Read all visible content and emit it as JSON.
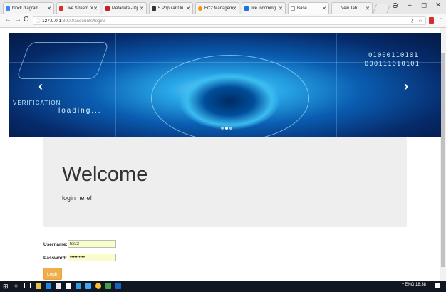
{
  "browser": {
    "tabs": [
      {
        "label": "block diagram",
        "favicon_color": "#4285f4",
        "active": false
      },
      {
        "label": "Live Stream pi",
        "favicon_color": "#d93025",
        "active": false
      },
      {
        "label": "Metadata - Dj",
        "favicon_color": "#c5221f",
        "active": false
      },
      {
        "label": "5 Popular Ou",
        "favicon_color": "#333333",
        "active": false
      },
      {
        "label": "EC2 Managem",
        "favicon_color": "#f29900",
        "active": false
      },
      {
        "label": "live Incoming",
        "favicon_color": "#1a73e8",
        "active": false
      },
      {
        "label": "Base",
        "favicon_color": "#9aa0a6",
        "active": true
      },
      {
        "label": "New Tab",
        "favicon_color": "#9aa0a6",
        "active": false
      }
    ],
    "url_host": "127.0.0.1",
    "url_path": ":8000/accounts/login/",
    "window_controls": {
      "minimize": "–",
      "maximize": "◻",
      "close": "✕"
    }
  },
  "hero": {
    "binary_top": "01000110101",
    "binary_bottom": "000111010101",
    "verification_text": "VERIFICATION",
    "loading_text": "loading...",
    "prev_arrow": "‹",
    "next_arrow": "›"
  },
  "jumbotron": {
    "title": "Welcome",
    "subtitle": "login here!"
  },
  "login_form": {
    "username_label": "Username:",
    "username_value": "test3",
    "password_label": "Password:",
    "password_value": "••••••••••",
    "submit_label": "Login"
  },
  "taskbar": {
    "tray_text": "^ ENG 18:38"
  },
  "colors": {
    "login_button": "#f0ad4e",
    "jumbotron_bg": "#eeeeee",
    "input_autofill_bg": "#fafccb",
    "taskbar_bg": "#101622"
  }
}
